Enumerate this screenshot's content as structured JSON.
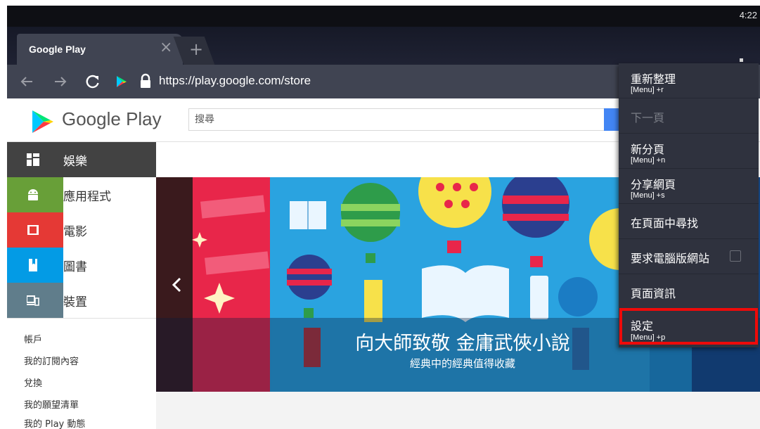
{
  "status_bar": {
    "time": "4:22"
  },
  "tabs": {
    "active_title": "Google Play",
    "close_glyph": "×",
    "new_tab_glyph": "+"
  },
  "toolbar": {
    "url": "https://play.google.com/store"
  },
  "page": {
    "logo_text": "Google Play",
    "search_placeholder": "搜尋",
    "categories": [
      {
        "label": "娛樂",
        "icon": "entertainment-icon",
        "color": "#424242"
      },
      {
        "label": "應用程式",
        "icon": "android-icon",
        "color": "#689f38"
      },
      {
        "label": "電影",
        "icon": "movies-icon",
        "color": "#e53935"
      },
      {
        "label": "圖書",
        "icon": "books-icon",
        "color": "#039be5"
      },
      {
        "label": "裝置",
        "icon": "devices-icon",
        "color": "#607d8b"
      }
    ],
    "account_links": [
      "帳戶",
      "我的訂閱內容",
      "兌換",
      "我的願望清單",
      "我的 Play 動態"
    ],
    "banner": {
      "title": "向大師致敬 金庸武俠小說",
      "subtitle": "經典中的經典值得收藏"
    }
  },
  "menu": {
    "items": [
      {
        "label": "重新整理",
        "shortcut": "[Menu] +r",
        "enabled": true
      },
      {
        "label": "下一頁",
        "shortcut": "",
        "enabled": false
      },
      {
        "label": "新分頁",
        "shortcut": "[Menu] +n",
        "enabled": true
      },
      {
        "label": "分享網頁",
        "shortcut": "[Menu] +s",
        "enabled": true
      },
      {
        "label": "在頁面中尋找",
        "shortcut": "",
        "enabled": true
      },
      {
        "label": "要求電腦版網站",
        "shortcut": "",
        "enabled": true,
        "checkbox": false
      },
      {
        "label": "頁面資訊",
        "shortcut": "",
        "enabled": true
      },
      {
        "label": "設定",
        "shortcut": "[Menu] +p",
        "enabled": true,
        "highlighted": true
      }
    ]
  },
  "colors": {
    "highlight": "#ee0a0a",
    "menu_bg": "#2f323e",
    "toolbar_bg": "#404452",
    "google_blue": "#4285f4"
  }
}
